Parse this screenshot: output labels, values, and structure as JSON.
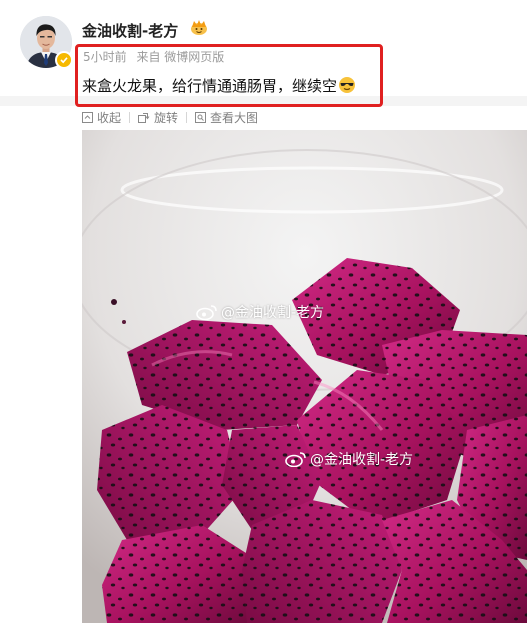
{
  "post": {
    "username": "金油收割-老方",
    "time": "5小时前",
    "source": "来自 微博网页版",
    "text": "来盒火龙果，给行情通通肠胃，继续空"
  },
  "actions": {
    "collapse": "收起",
    "rotate": "旋转",
    "view_large": "查看大图"
  },
  "image": {
    "watermark_1": "@金油收割-老方",
    "watermark_2": "@金油收割-老方"
  },
  "icons": {
    "avatar_badge": "verified-icon",
    "crown": "crown-icon",
    "emoji": "sunglasses-emoji-icon",
    "collapse": "collapse-icon",
    "rotate": "rotate-icon",
    "view": "view-large-icon",
    "weibo": "weibo-logo-icon"
  },
  "colors": {
    "highlight_border": "#e02020",
    "verified_badge": "#f6b900",
    "dragon_fruit": "#a8125f",
    "meta_text": "#9b9b9b"
  }
}
